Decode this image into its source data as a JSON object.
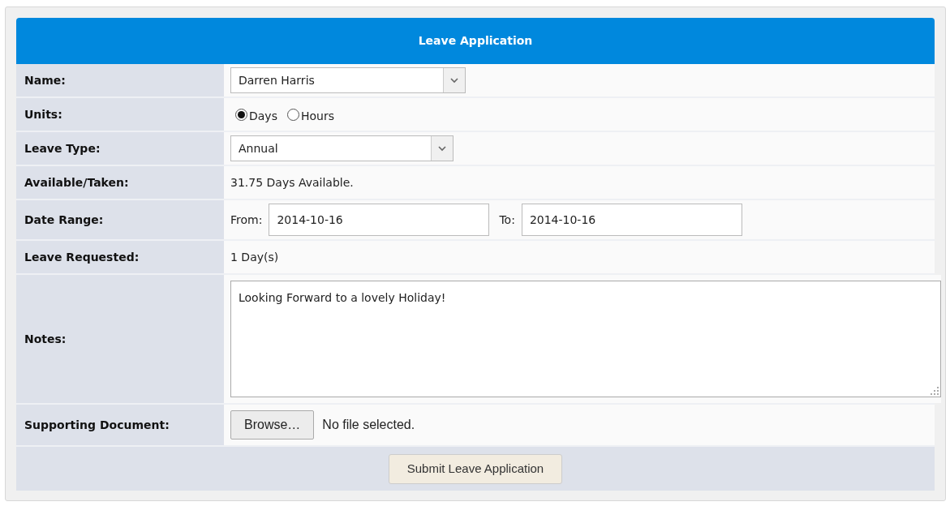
{
  "form": {
    "title": "Leave Application",
    "fields": [
      {
        "kind": "select",
        "label": "Name:",
        "value": "Darren Harris"
      },
      {
        "kind": "radio",
        "label": "Units:",
        "options": [
          {
            "label": "Days",
            "selected": true
          },
          {
            "label": "Hours",
            "selected": false
          }
        ]
      },
      {
        "kind": "select",
        "label": "Leave Type:",
        "value": "Annual"
      },
      {
        "kind": "text",
        "label": "Available/Taken:",
        "value": "31.75 Days Available."
      },
      {
        "kind": "daterange",
        "label": "Date Range:",
        "from_label": "From:",
        "from": "2014-10-16",
        "to_label": "To:",
        "to": "2014-10-16"
      },
      {
        "kind": "text",
        "label": "Leave Requested:",
        "value": "1 Day(s)"
      },
      {
        "kind": "textarea",
        "label": "Notes:",
        "value": "Looking Forward to a lovely Holiday!"
      },
      {
        "kind": "file",
        "label": "Supporting Document:",
        "button": "Browse…",
        "status": "No file selected."
      }
    ],
    "submit": "Submit Leave Application"
  }
}
